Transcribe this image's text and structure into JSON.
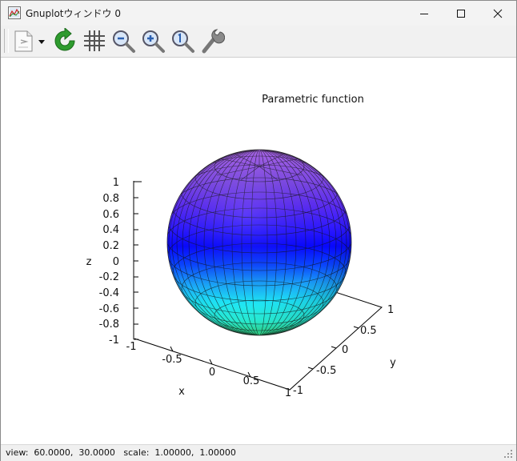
{
  "window": {
    "title": "Gnuplotウィンドウ 0",
    "icon": "gnuplot-app-icon"
  },
  "title_controls": {
    "minimize": "minimize-icon",
    "maximize": "maximize-icon",
    "close": "close-icon"
  },
  "toolbar": {
    "items": [
      "copy-icon",
      "dropdown-arrow-icon",
      "replot-icon",
      "grid-icon",
      "zoom-out-icon",
      "zoom-in-icon",
      "zoom-reset-icon",
      "settings-wrench-icon"
    ]
  },
  "plot": {
    "title": "Parametric function",
    "z_axis": {
      "label": "z",
      "ticks": [
        "1",
        "0.8",
        "0.6",
        "0.4",
        "0.2",
        "0",
        "-0.2",
        "-0.4",
        "-0.6",
        "-0.8",
        "-1"
      ]
    },
    "x_axis": {
      "label": "x",
      "ticks": [
        "-1",
        "-0.5",
        "0",
        "0.5",
        "1"
      ]
    },
    "y_axis": {
      "label": "y",
      "ticks": [
        "-1",
        "-0.5",
        "0",
        "0.5",
        "1"
      ]
    }
  },
  "status": {
    "text": "view:  60.0000,  30.0000   scale:  1.00000,  1.00000"
  }
}
